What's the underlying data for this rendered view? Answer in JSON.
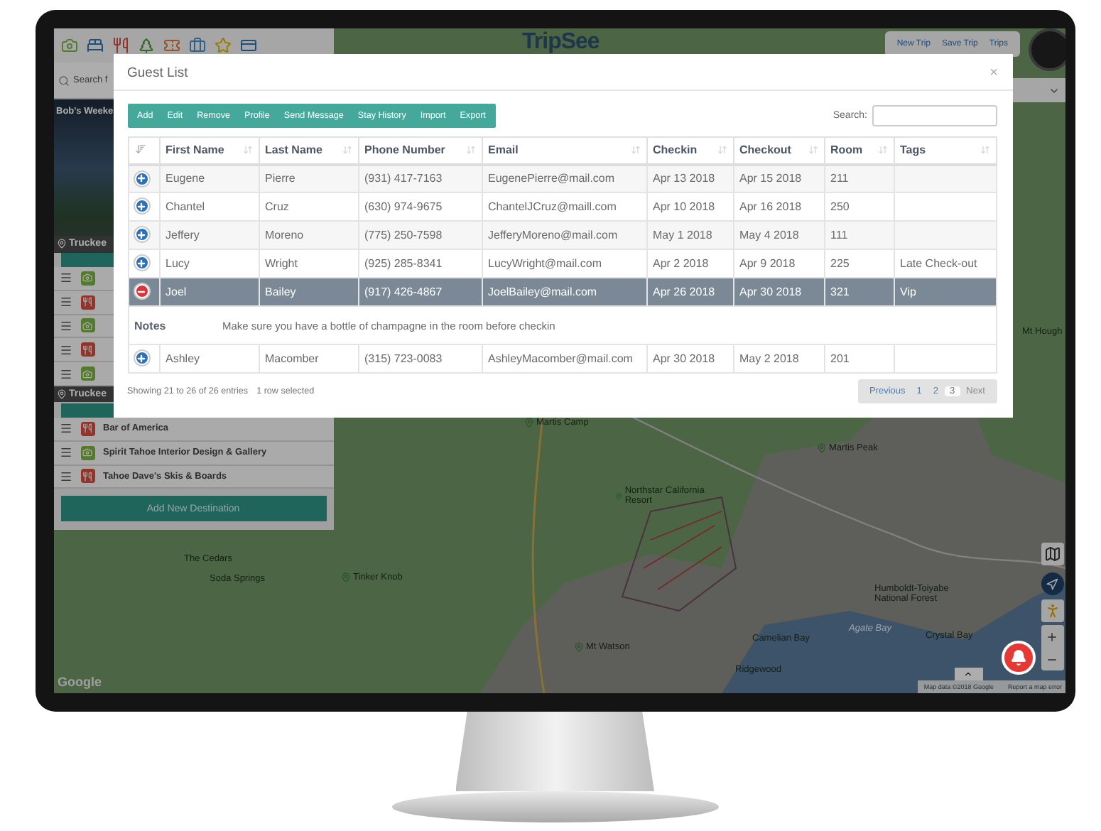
{
  "sidebar": {
    "search_placeholder": "Search f",
    "trip_title": "Bob's Weeke",
    "groups": [
      {
        "location": "Truckee",
        "items": [
          {
            "kind": "sight"
          },
          {
            "kind": "food"
          },
          {
            "kind": "sight"
          },
          {
            "kind": "food"
          },
          {
            "kind": "sight"
          }
        ]
      },
      {
        "location": "Truckee",
        "items": [
          {
            "kind": "food",
            "name": "Bar of America"
          },
          {
            "kind": "sight",
            "name": "Spirit Tahoe Interior Design & Gallery"
          },
          {
            "kind": "food",
            "name": "Tahoe Dave's Skis & Boards"
          }
        ]
      }
    ],
    "add_button": "Add New Destination"
  },
  "logo": "TripSee",
  "top_nav": [
    "New Trip",
    "Save Trip",
    "Trips"
  ],
  "map": {
    "places": [
      {
        "name": "Martis Camp",
        "kind": "pin"
      },
      {
        "name": "Martis Peak",
        "kind": "pin"
      },
      {
        "name": "Northstar California Resort",
        "kind": "pin"
      },
      {
        "name": "Tinker Knob",
        "kind": "pin"
      },
      {
        "name": "Mt Watson",
        "kind": "pin"
      },
      {
        "name": "Camelian Bay",
        "kind": "text"
      },
      {
        "name": "Ridgewood",
        "kind": "text"
      },
      {
        "name": "Humboldt-Toiyabe National Forest",
        "kind": "text"
      },
      {
        "name": "Agate Bay",
        "kind": "water"
      },
      {
        "name": "Crystal Bay",
        "kind": "text"
      },
      {
        "name": "Soda Springs",
        "kind": "text"
      },
      {
        "name": "The Cedars",
        "kind": "text"
      },
      {
        "name": "Mt Hough",
        "kind": "text"
      }
    ],
    "logo": "Google",
    "attribution": "Map data ©2018 Google",
    "report": "Report a map error"
  },
  "dialog": {
    "title": "Guest List",
    "close": "×",
    "toolbar": [
      "Add",
      "Edit",
      "Remove",
      "Profile",
      "Send Message",
      "Stay History",
      "Import",
      "Export"
    ],
    "search_label": "Search:",
    "columns": [
      "First Name",
      "Last Name",
      "Phone Number",
      "Email",
      "Checkin",
      "Checkout",
      "Room",
      "Tags"
    ],
    "rows": [
      {
        "first": "Eugene",
        "last": "Pierre",
        "phone": "(931) 417-7163",
        "email": "EugenePierre@mail.com",
        "checkin": "Apr 13 2018",
        "checkout": "Apr 15 2018",
        "room": "211",
        "tags": "",
        "expanded": false,
        "selected": false
      },
      {
        "first": "Chantel",
        "last": "Cruz",
        "phone": "(630) 974-9675",
        "email": "ChantelJCruz@maill.com",
        "checkin": "Apr 10 2018",
        "checkout": "Apr 16 2018",
        "room": "250",
        "tags": "",
        "expanded": false,
        "selected": false
      },
      {
        "first": "Jeffery",
        "last": "Moreno",
        "phone": "(775) 250-7598",
        "email": "JefferyMoreno@mail.com",
        "checkin": "May 1 2018",
        "checkout": "May 4 2018",
        "room": "111",
        "tags": "",
        "expanded": false,
        "selected": false
      },
      {
        "first": "Lucy",
        "last": "Wright",
        "phone": "(925) 285-8341",
        "email": "LucyWright@mail.com",
        "checkin": "Apr 2 2018",
        "checkout": "Apr 9 2018",
        "room": "225",
        "tags": "Late Check-out",
        "expanded": false,
        "selected": false
      },
      {
        "first": "Joel",
        "last": "Bailey",
        "phone": "(917) 426-4867",
        "email": "JoelBailey@mail.com",
        "checkin": "Apr 26 2018",
        "checkout": "Apr 30 2018",
        "room": "321",
        "tags": "Vip",
        "expanded": true,
        "selected": true,
        "notes_label": "Notes",
        "notes": "Make sure you have a bottle of champagne in the room before checkin"
      },
      {
        "first": "Ashley",
        "last": "Macomber",
        "phone": "(315) 723-0083",
        "email": "AshleyMacomber@mail.com",
        "checkin": "Apr 30 2018",
        "checkout": "May 2 2018",
        "room": "201",
        "tags": "",
        "expanded": false,
        "selected": false
      }
    ],
    "info": "Showing 21 to 26 of 26 entries",
    "selection_info": "1 row selected",
    "pagination": [
      {
        "label": "Previous",
        "kind": "nav",
        "disabled": false
      },
      {
        "label": "1",
        "kind": "page",
        "selected": false
      },
      {
        "label": "2",
        "kind": "page",
        "selected": false
      },
      {
        "label": "3",
        "kind": "page",
        "selected": true
      },
      {
        "label": "Next",
        "kind": "nav",
        "disabled": true
      }
    ]
  }
}
